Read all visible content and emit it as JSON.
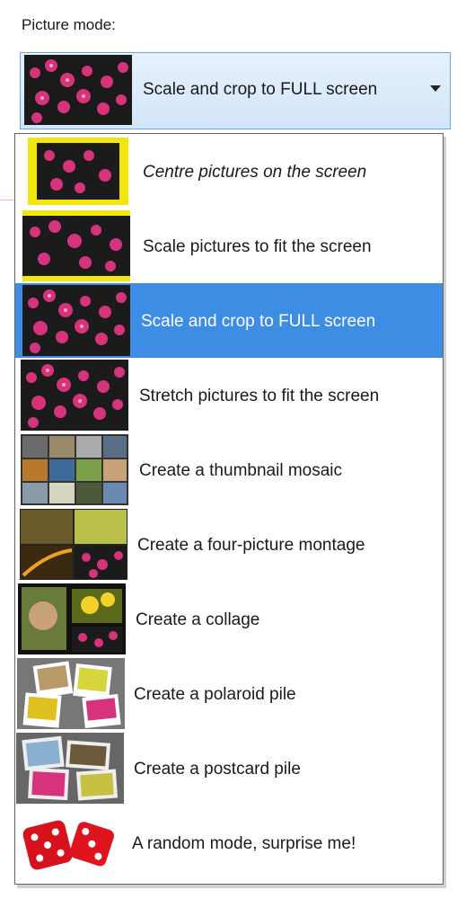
{
  "label": "Picture mode:",
  "combo": {
    "value": "Scale and crop to FULL screen",
    "icon": "flower-thumbnail-icon"
  },
  "colors": {
    "selection": "#3e8de5",
    "combo_border": "#6fa6d6",
    "thumb_highlight": "#f3e60a"
  },
  "options": [
    {
      "label": "Centre pictures on the screen",
      "icon": "centre-thumbnail-icon"
    },
    {
      "label": "Scale pictures to fit the screen",
      "icon": "scale-fit-thumbnail-icon"
    },
    {
      "label": "Scale and crop to FULL screen",
      "icon": "scale-crop-thumbnail-icon",
      "selected": true
    },
    {
      "label": "Stretch pictures to fit the screen",
      "icon": "stretch-thumbnail-icon"
    },
    {
      "label": "Create a thumbnail mosaic",
      "icon": "mosaic-thumbnail-icon"
    },
    {
      "label": "Create a four-picture montage",
      "icon": "montage-thumbnail-icon"
    },
    {
      "label": "Create a collage",
      "icon": "collage-thumbnail-icon"
    },
    {
      "label": "Create a polaroid pile",
      "icon": "polaroid-thumbnail-icon"
    },
    {
      "label": "Create a postcard pile",
      "icon": "postcard-thumbnail-icon"
    },
    {
      "label": "A random mode, surprise me!",
      "icon": "dice-icon"
    }
  ]
}
